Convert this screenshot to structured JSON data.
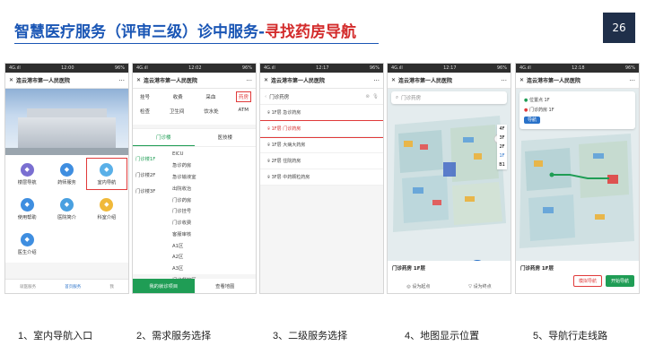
{
  "slide": {
    "title_main": "智慧医疗服务（评审三级）诊中服务-",
    "title_highlight": "寻找药房导航",
    "page_number": "26",
    "title_color": "#1a56b5",
    "highlight_color": "#d32b2b"
  },
  "app": {
    "hospital": "连云港市第一人民医院",
    "menu_glyph": "···"
  },
  "phone1": {
    "status_left": "4G.ıll",
    "status_time": "12:00",
    "status_right": "96%",
    "grid": [
      {
        "label": "楼层导航",
        "icon": "layers-icon",
        "color": "#7a6fd1"
      },
      {
        "label": "药师服务",
        "icon": "pharmacist-icon",
        "color": "#3f8ee0"
      },
      {
        "label": "室内导航",
        "icon": "indoor-map-icon",
        "color": "#5ab0e8"
      },
      {
        "label": "使用帮助",
        "icon": "help-icon",
        "color": "#3f8ee0"
      },
      {
        "label": "医院简介",
        "icon": "hospital-icon",
        "color": "#49a0e0"
      },
      {
        "label": "科室介绍",
        "icon": "department-icon",
        "color": "#f0b93a"
      },
      {
        "label": "医生介绍",
        "icon": "doctor-icon",
        "color": "#3f8ee0"
      }
    ],
    "tabs": [
      "就医服务",
      "首页服务",
      "我"
    ]
  },
  "phone2": {
    "status_time": "12:02",
    "row1": [
      "挂号",
      "收费",
      "采血",
      "药房"
    ],
    "row2": [
      "检查",
      "卫生间",
      "饮水处",
      "ATM"
    ],
    "segments": [
      "门诊楼",
      "医技楼"
    ],
    "floors": [
      "门诊楼1F",
      "门诊楼2F",
      "门诊楼3F"
    ],
    "places": [
      "EICU",
      "急诊药房",
      "急诊输液室",
      "出院收治",
      "门诊药房",
      "门诊挂号",
      "门诊收费",
      "客服审核",
      "A1区",
      "A2区",
      "A3区",
      "门诊餐饮区",
      "自助取药窗"
    ],
    "footer_left": "我的就诊项目",
    "footer_right": "查看地图"
  },
  "phone3": {
    "status_time": "12:17",
    "search_value": "门诊药房",
    "results": [
      "1F层 急诊药房",
      "1F层 门诊药房",
      "1F层 大病大药房",
      "2F层 住院药房",
      "3F层 中药颗粒药房"
    ]
  },
  "phone4": {
    "status_time": "12:17",
    "search_placeholder": "门诊药房",
    "floors": [
      "4F",
      "3F",
      "2F",
      "1F",
      "B1"
    ],
    "place_title": "门诊药房 1F层",
    "btn_start": "设为起点",
    "btn_end": "设为终点"
  },
  "phone5": {
    "status_time": "12:18",
    "from": "位置点 1F",
    "to": "门诊药房 1F",
    "mode": "导航",
    "place_title": "门诊药房 1F层",
    "btn_sim": "模拟导航",
    "btn_go": "开始导航"
  },
  "captions": [
    "1、室内导航入口",
    "2、需求服务选择",
    "3、二级服务选择",
    "4、地图显示位置",
    "5、导航行走线路"
  ]
}
